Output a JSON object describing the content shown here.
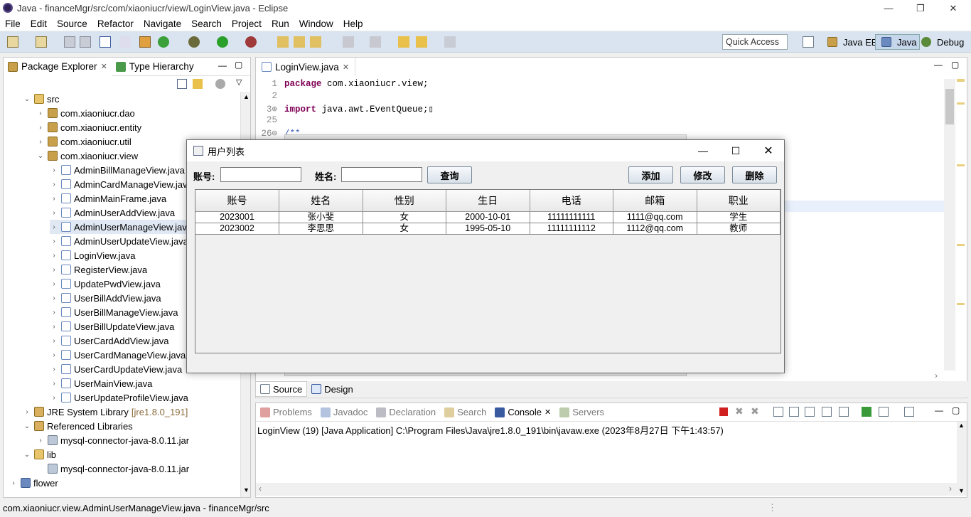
{
  "window": {
    "title": "Java - financeMgr/src/com/xiaoniucr/view/LoginView.java - Eclipse",
    "minimize": "—",
    "restore": "❐",
    "close": "✕"
  },
  "menu": [
    "File",
    "Edit",
    "Source",
    "Refactor",
    "Navigate",
    "Search",
    "Project",
    "Run",
    "Window",
    "Help"
  ],
  "toolbar": {
    "quick_access": "Quick Access",
    "perspectives": [
      "Java EE",
      "Java",
      "Debug"
    ]
  },
  "left_panel": {
    "tabs": [
      "Package Explorer",
      "Type Hierarchy"
    ],
    "tree": [
      {
        "label": "src",
        "indent": 1,
        "arrow": "⌄",
        "icon": "src"
      },
      {
        "label": "com.xiaoniucr.dao",
        "indent": 2,
        "arrow": "›",
        "icon": "pkg"
      },
      {
        "label": "com.xiaoniucr.entity",
        "indent": 2,
        "arrow": "›",
        "icon": "pkg"
      },
      {
        "label": "com.xiaoniucr.util",
        "indent": 2,
        "arrow": "›",
        "icon": "pkg"
      },
      {
        "label": "com.xiaoniucr.view",
        "indent": 2,
        "arrow": "⌄",
        "icon": "pkg"
      },
      {
        "label": "AdminBillManageView.java",
        "indent": 3,
        "arrow": "›",
        "icon": "java"
      },
      {
        "label": "AdminCardManageView.java",
        "indent": 3,
        "arrow": "›",
        "icon": "java"
      },
      {
        "label": "AdminMainFrame.java",
        "indent": 3,
        "arrow": "›",
        "icon": "java"
      },
      {
        "label": "AdminUserAddView.java",
        "indent": 3,
        "arrow": "›",
        "icon": "java"
      },
      {
        "label": "AdminUserManageView.java",
        "indent": 3,
        "arrow": "›",
        "icon": "java",
        "selected": true
      },
      {
        "label": "AdminUserUpdateView.java",
        "indent": 3,
        "arrow": "›",
        "icon": "java"
      },
      {
        "label": "LoginView.java",
        "indent": 3,
        "arrow": "›",
        "icon": "java"
      },
      {
        "label": "RegisterView.java",
        "indent": 3,
        "arrow": "›",
        "icon": "java"
      },
      {
        "label": "UpdatePwdView.java",
        "indent": 3,
        "arrow": "›",
        "icon": "java"
      },
      {
        "label": "UserBillAddView.java",
        "indent": 3,
        "arrow": "›",
        "icon": "java"
      },
      {
        "label": "UserBillManageView.java",
        "indent": 3,
        "arrow": "›",
        "icon": "java"
      },
      {
        "label": "UserBillUpdateView.java",
        "indent": 3,
        "arrow": "›",
        "icon": "java"
      },
      {
        "label": "UserCardAddView.java",
        "indent": 3,
        "arrow": "›",
        "icon": "java"
      },
      {
        "label": "UserCardManageView.java",
        "indent": 3,
        "arrow": "›",
        "icon": "java"
      },
      {
        "label": "UserCardUpdateView.java",
        "indent": 3,
        "arrow": "›",
        "icon": "java"
      },
      {
        "label": "UserMainView.java",
        "indent": 3,
        "arrow": "›",
        "icon": "java"
      },
      {
        "label": "UserUpdateProfileView.java",
        "indent": 3,
        "arrow": "›",
        "icon": "java"
      },
      {
        "label": "JRE System Library",
        "suffix": "[jre1.8.0_191]",
        "indent": 1,
        "arrow": "›",
        "icon": "lib"
      },
      {
        "label": "Referenced Libraries",
        "indent": 1,
        "arrow": "⌄",
        "icon": "lib"
      },
      {
        "label": "mysql-connector-java-8.0.11.jar",
        "indent": 2,
        "arrow": "›",
        "icon": "jar"
      },
      {
        "label": "lib",
        "indent": 1,
        "arrow": "⌄",
        "icon": "src"
      },
      {
        "label": "mysql-connector-java-8.0.11.jar",
        "indent": 2,
        "arrow": "",
        "icon": "jar"
      },
      {
        "label": "flower",
        "indent": 0,
        "arrow": "›",
        "icon": "proj"
      }
    ]
  },
  "editor": {
    "tab": "LoginView.java",
    "lines": [
      {
        "num": "1",
        "kw": "package",
        "rest": " com.xiaoniucr.view;"
      },
      {
        "num": "2",
        "kw": "",
        "rest": ""
      },
      {
        "num": "3⊕",
        "kw": "import",
        "rest": " java.awt.EventQueue;▯"
      },
      {
        "num": "25",
        "kw": "",
        "rest": ""
      },
      {
        "num": "26⊖",
        "kw": "",
        "rest": "/**"
      }
    ],
    "bottom_tabs": [
      "Source",
      "Design"
    ]
  },
  "console": {
    "tabs": [
      "Problems",
      "Javadoc",
      "Declaration",
      "Search",
      "Console",
      "Servers"
    ],
    "text": "LoginView (19) [Java Application] C:\\Program Files\\Java\\jre1.8.0_191\\bin\\javaw.exe (2023年8月27日 下午1:43:57)"
  },
  "status": "com.xiaoniucr.view.AdminUserManageView.java - financeMgr/src",
  "dialog": {
    "title": "用户列表",
    "account_label": "账号:",
    "account_value": "",
    "name_label": "姓名:",
    "name_value": "",
    "query_btn": "查询",
    "add_btn": "添加",
    "edit_btn": "修改",
    "delete_btn": "删除",
    "columns": [
      "账号",
      "姓名",
      "性别",
      "生日",
      "电话",
      "邮箱",
      "职业"
    ],
    "rows": [
      [
        "2023001",
        "张小斐",
        "女",
        "2000-10-01",
        "11111111111",
        "1111@qq.com",
        "学生"
      ],
      [
        "2023002",
        "李思思",
        "女",
        "1995-05-10",
        "11111111112",
        "1112@qq.com",
        "教师"
      ]
    ]
  }
}
